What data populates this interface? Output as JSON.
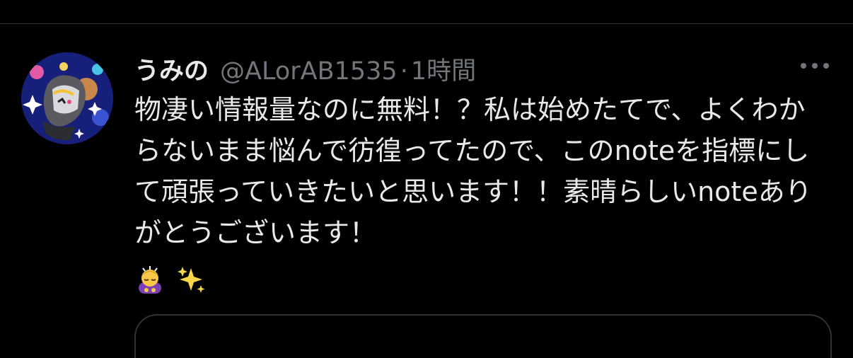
{
  "tweet": {
    "display_name": "うみの",
    "handle": "@ALorAB1535",
    "separator": "·",
    "timestamp": "1時間",
    "text": "物凄い情報量なのに無料！？私は始めたてで、よくわからないまま悩んで彷徨ってたので、このnoteを指標にして頑張っていきたいと思います！！素晴らしいnoteありがとうございます！",
    "emojis": [
      "person-bowing-emoji",
      "sparkles-emoji"
    ],
    "more_icon": "more-horizontal-icon"
  },
  "colors": {
    "background": "#000000",
    "primary_text": "#e7e9ea",
    "secondary_text": "#71767b",
    "divider": "#2f3336"
  }
}
